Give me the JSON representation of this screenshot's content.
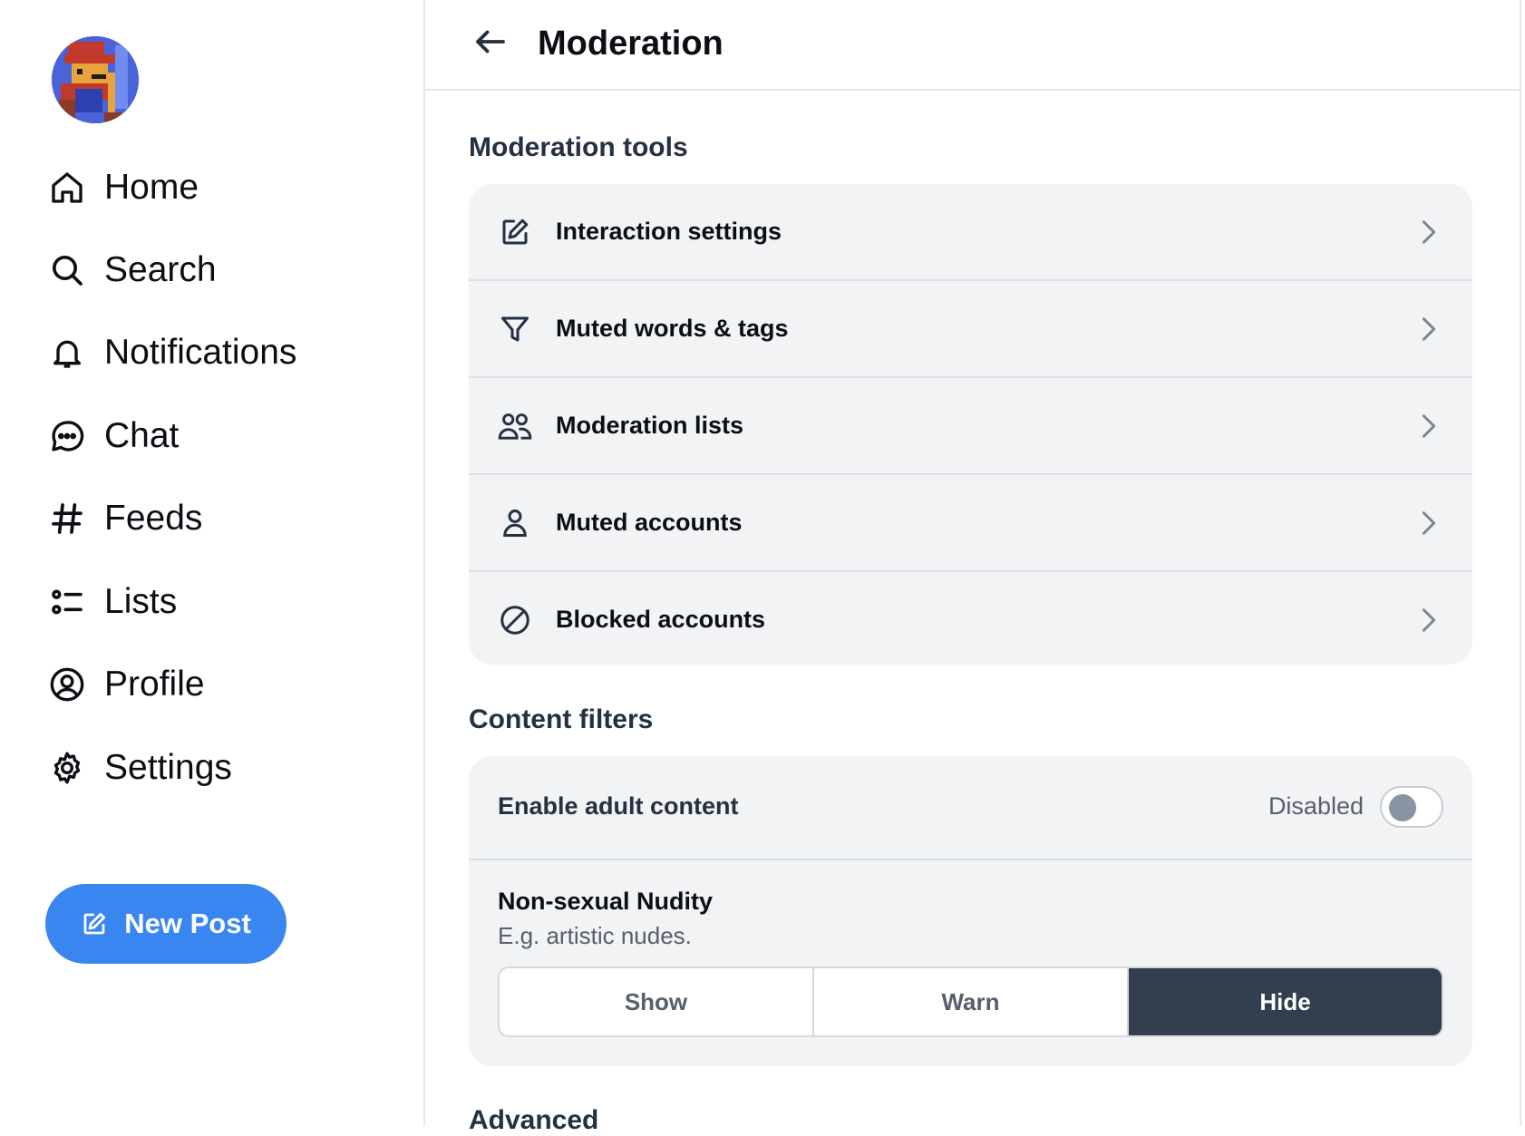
{
  "sidebar": {
    "nav": [
      {
        "label": "Home",
        "icon": "home-icon"
      },
      {
        "label": "Search",
        "icon": "search-icon"
      },
      {
        "label": "Notifications",
        "icon": "bell-icon"
      },
      {
        "label": "Chat",
        "icon": "chat-bubble-icon"
      },
      {
        "label": "Feeds",
        "icon": "hashtag-icon"
      },
      {
        "label": "Lists",
        "icon": "list-icon"
      },
      {
        "label": "Profile",
        "icon": "user-circle-icon"
      },
      {
        "label": "Settings",
        "icon": "gear-icon"
      }
    ],
    "new_post_label": "New Post"
  },
  "header": {
    "title": "Moderation"
  },
  "moderation_tools": {
    "title": "Moderation tools",
    "items": [
      {
        "label": "Interaction settings",
        "icon": "edit-icon"
      },
      {
        "label": "Muted words & tags",
        "icon": "filter-icon"
      },
      {
        "label": "Moderation lists",
        "icon": "users-icon"
      },
      {
        "label": "Muted accounts",
        "icon": "person-icon"
      },
      {
        "label": "Blocked accounts",
        "icon": "block-icon"
      }
    ]
  },
  "content_filters": {
    "title": "Content filters",
    "adult_content": {
      "label": "Enable adult content",
      "status": "Disabled",
      "enabled": false
    },
    "nudity": {
      "title": "Non-sexual Nudity",
      "description": "E.g. artistic nudes.",
      "options": [
        "Show",
        "Warn",
        "Hide"
      ],
      "selected": "Hide"
    }
  },
  "advanced": {
    "title": "Advanced"
  },
  "colors": {
    "accent": "#3a86f1",
    "card_bg": "#f1f3f5",
    "selected_segment": "#333e4e"
  }
}
